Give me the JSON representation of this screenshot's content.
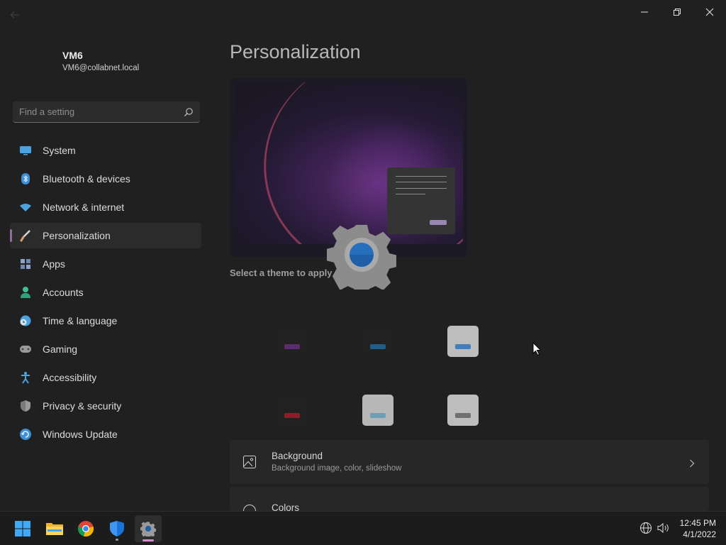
{
  "user": {
    "name": "VM6",
    "email": "VM6@collabnet.local"
  },
  "search": {
    "placeholder": "Find a setting"
  },
  "nav": {
    "items": [
      {
        "label": "System",
        "icon": "monitor-icon",
        "color": "#4aa3df"
      },
      {
        "label": "Bluetooth & devices",
        "icon": "bluetooth-icon",
        "color": "#3f8fd6"
      },
      {
        "label": "Network & internet",
        "icon": "wifi-icon",
        "color": "#4aa3df"
      },
      {
        "label": "Personalization",
        "icon": "brush-icon",
        "color": "#e0a070",
        "active": true
      },
      {
        "label": "Apps",
        "icon": "apps-icon",
        "color": "#8fa3c8"
      },
      {
        "label": "Accounts",
        "icon": "person-icon",
        "color": "#3fbf8c"
      },
      {
        "label": "Time & language",
        "icon": "clock-globe-icon",
        "color": "#4aa3df"
      },
      {
        "label": "Gaming",
        "icon": "gamepad-icon",
        "color": "#9a9a9a"
      },
      {
        "label": "Accessibility",
        "icon": "accessibility-icon",
        "color": "#4aa3df"
      },
      {
        "label": "Privacy & security",
        "icon": "shield-icon",
        "color": "#9a9a9a"
      },
      {
        "label": "Windows Update",
        "icon": "refresh-icon",
        "color": "#3f8fd6"
      }
    ]
  },
  "main": {
    "title": "Personalization",
    "theme_caption": "Select a theme to apply",
    "themes": [
      {
        "bg": "#212121",
        "bar": "#5c2c70"
      },
      {
        "bg": "#212121",
        "bar": "#1f5d8a"
      },
      {
        "bg": "#bdbdbd",
        "bar": "#3f7fbf"
      },
      {
        "bg": "#212121",
        "bar": "#8a1f2a"
      },
      {
        "bg": "#b8b8b8",
        "bar": "#6f9fb5"
      },
      {
        "bg": "#bdbdbd",
        "bar": "#707070"
      }
    ],
    "rows": [
      {
        "title": "Background",
        "subtitle": "Background image, color, slideshow",
        "icon": "image-icon"
      },
      {
        "title": "Colors",
        "subtitle": "",
        "icon": "palette-icon"
      }
    ]
  },
  "taskbar": {
    "apps": [
      "start-icon",
      "file-explorer-icon",
      "chrome-icon",
      "defender-icon",
      "settings-icon"
    ],
    "time": "12:45 PM",
    "date": "4/1/2022"
  },
  "colors": {
    "accent": "#8e6f9c",
    "background": "#202020"
  }
}
